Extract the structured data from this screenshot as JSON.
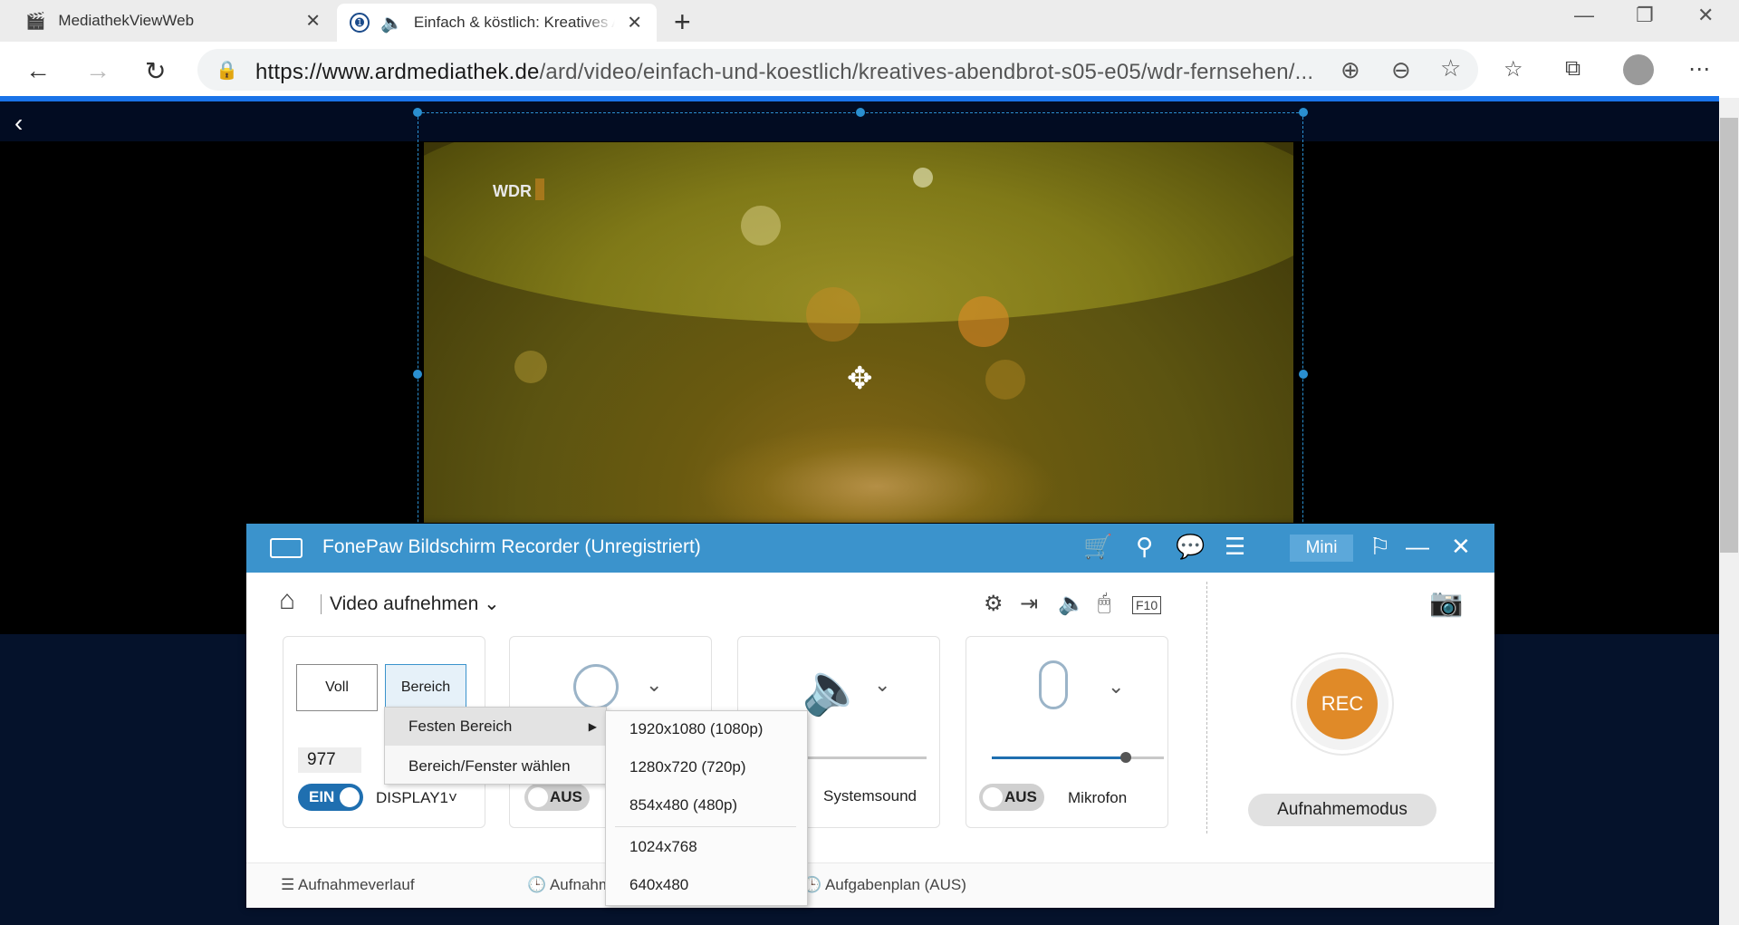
{
  "browser": {
    "tabs": [
      {
        "label": "MediathekViewWeb"
      },
      {
        "label": "Einfach & köstlich: Kreatives Abendbrot"
      }
    ],
    "url_host": "https://www.ardmediathek.de",
    "url_path": "/ard/video/einfach-und-koestlich/kreatives-abendbrot-s05-e05/wdr-fernsehen/..."
  },
  "video": {
    "channel_logo": "WDR"
  },
  "recorder": {
    "title": "FonePaw Bildschirm Recorder (Unregistriert)",
    "mini_label": "Mini",
    "mode_label": "Video aufnehmen",
    "area": {
      "full_label": "Voll",
      "region_label": "Bereich",
      "width_value": "977",
      "toggle_label": "EIN",
      "display_label": "DISPLAY1"
    },
    "webcam": {
      "toggle_label": "AUS"
    },
    "system_sound": {
      "label": "Systemsound"
    },
    "microphone": {
      "toggle_label": "AUS",
      "label": "Mikrofon",
      "volume": 0.78
    },
    "rec_label": "REC",
    "record_mode_label": "Aufnahmemodus",
    "footer": {
      "history": "Aufnahmeverlauf",
      "record_length": "Aufnahm",
      "schedule": "Aufgabenplan (AUS)"
    },
    "region_menu": {
      "items": [
        "Festen Bereich",
        "Bereich/Fenster wählen"
      ]
    },
    "fixed_sizes": [
      "1920x1080 (1080p)",
      "1280x720 (720p)",
      "854x480 (480p)",
      "1024x768",
      "640x480"
    ]
  },
  "colors": {
    "accent": "#3b93cc",
    "rec": "#e08a28",
    "toggle_on": "#1f6fb0"
  }
}
